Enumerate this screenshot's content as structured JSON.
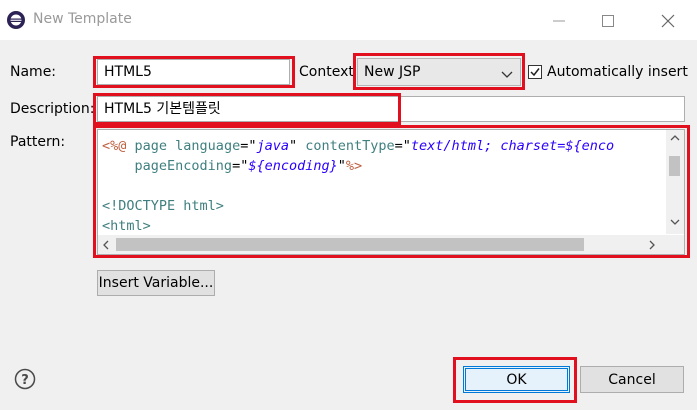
{
  "window": {
    "title": "New Template"
  },
  "form": {
    "name_label": "Name:",
    "name_value": "HTML5",
    "context_label": "Context",
    "context_value": "New JSP",
    "auto_insert_label": "Automatically insert",
    "auto_insert_checked": true,
    "description_label": "Description:",
    "description_value": "HTML5 기본템플릿",
    "pattern_label": "Pattern:"
  },
  "pattern": {
    "line1": {
      "open": "<%@",
      "p1": " page ",
      "a1": "language",
      "eq1": "=\"",
      "v1": "java",
      "q1": "\" ",
      "a2": "contentType",
      "eq2": "=\"",
      "v2": "text/html; charset=${enco"
    },
    "line2": {
      "indent": "    ",
      "a3": "pageEncoding",
      "eq3": "=\"",
      "v3": "${encoding}",
      "q3": "\"",
      "close": "%>"
    },
    "line4": "<!DOCTYPE html>",
    "line5": "<html>"
  },
  "buttons": {
    "insert_variable": "Insert Variable...",
    "ok": "OK",
    "cancel": "Cancel"
  },
  "colors": {
    "highlight_box": "#e2101e",
    "jsp_delimiter": "#bf5f3f",
    "attribute": "#3f7f7f",
    "string_value": "#2a00ff"
  },
  "icons": {
    "app": "eclipse-icon",
    "minimize": "minimize-icon",
    "maximize": "maximize-icon",
    "close": "close-icon",
    "help": "help-icon"
  }
}
